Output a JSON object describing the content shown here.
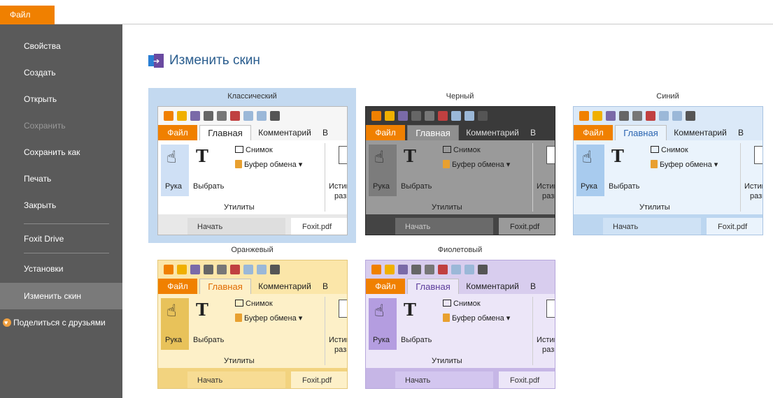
{
  "menu": {
    "file_tab": "Файл"
  },
  "sidebar": {
    "items": [
      {
        "label": "Свойства"
      },
      {
        "label": "Создать"
      },
      {
        "label": "Открыть"
      },
      {
        "label": "Сохранить"
      },
      {
        "label": "Сохранить как"
      },
      {
        "label": "Печать"
      },
      {
        "label": "Закрыть"
      },
      {
        "label": "Foxit Drive"
      },
      {
        "label": "Установки"
      },
      {
        "label": "Изменить скин"
      }
    ],
    "share": "Поделиться с друзьями",
    "disabled_item": "Сохранить",
    "active_item": "Изменить скин"
  },
  "main": {
    "title": "Изменить скин",
    "selected_skin": "Классический"
  },
  "preview_text": {
    "file": "Файл",
    "home": "Главная",
    "comment": "Комментарий",
    "more": "В",
    "snapshot": "Снимок",
    "clipboard": "Буфер обмена",
    "hand": "Рука",
    "select": "Выбрать",
    "utilities": "Утилиты",
    "ist1": "Истин",
    "ist2": "разм",
    "tab_start": "Начать",
    "tab_doc": "Foxit.pdf"
  },
  "skins": [
    {
      "name": "Классический",
      "theme": "classic"
    },
    {
      "name": "Черный",
      "theme": "black"
    },
    {
      "name": "Синий",
      "theme": "blue"
    },
    {
      "name": "Оранжевый",
      "theme": "orange"
    },
    {
      "name": "Фиолетовый",
      "theme": "purple"
    }
  ],
  "colors": {
    "accent": "#f08000",
    "sidebar_bg": "#5a5a5a",
    "selected_bg": "#c3d9f0",
    "title": "#2a5d8e"
  },
  "icons": [
    "heart-icon",
    "skin-title-icon",
    "hand-icon",
    "select-icon",
    "snapshot-icon",
    "clipboard-icon"
  ]
}
